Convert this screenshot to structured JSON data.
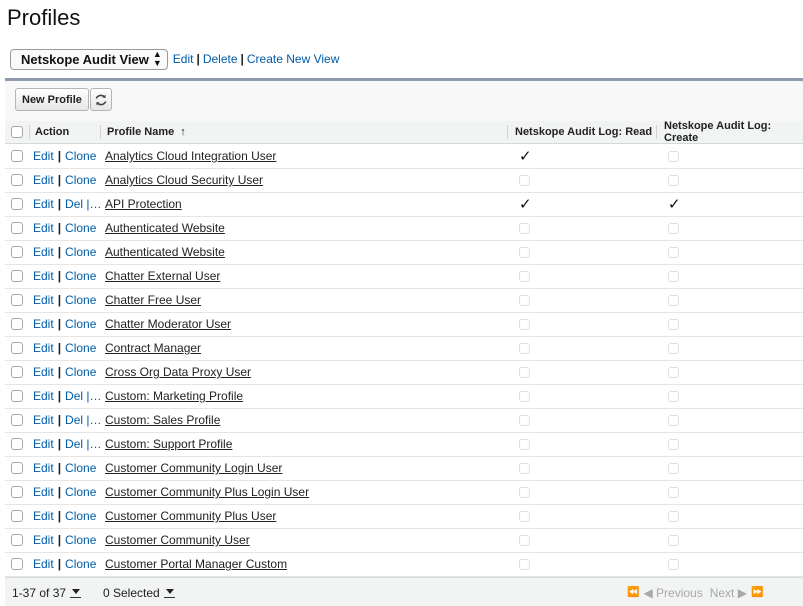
{
  "page_title": "Profiles",
  "view": {
    "selected": "Netskope Audit View",
    "edit_label": "Edit",
    "delete_label": "Delete",
    "create_label": "Create New View"
  },
  "toolbar": {
    "new_profile_label": "New Profile",
    "refresh_icon": "refresh-icon"
  },
  "columns": {
    "action": "Action",
    "profile_name": "Profile Name",
    "sort_indicator": "↑",
    "read": "Netskope Audit Log: Read",
    "create": "Netskope Audit Log: Create"
  },
  "rows": [
    {
      "action1": "Edit",
      "action2": "Clone",
      "name": "Analytics Cloud Integration User",
      "read": true,
      "create": false
    },
    {
      "action1": "Edit",
      "action2": "Clone",
      "name": "Analytics Cloud Security User",
      "read": false,
      "create": false
    },
    {
      "action1": "Edit",
      "action2": "Del |…",
      "name": "API Protection",
      "read": true,
      "create": true
    },
    {
      "action1": "Edit",
      "action2": "Clone",
      "name": "Authenticated Website",
      "read": false,
      "create": false
    },
    {
      "action1": "Edit",
      "action2": "Clone",
      "name": "Authenticated Website",
      "read": false,
      "create": false
    },
    {
      "action1": "Edit",
      "action2": "Clone",
      "name": "Chatter External User",
      "read": false,
      "create": false
    },
    {
      "action1": "Edit",
      "action2": "Clone",
      "name": "Chatter Free User",
      "read": false,
      "create": false
    },
    {
      "action1": "Edit",
      "action2": "Clone",
      "name": "Chatter Moderator User",
      "read": false,
      "create": false
    },
    {
      "action1": "Edit",
      "action2": "Clone",
      "name": "Contract Manager",
      "read": false,
      "create": false
    },
    {
      "action1": "Edit",
      "action2": "Clone",
      "name": "Cross Org Data Proxy User",
      "read": false,
      "create": false
    },
    {
      "action1": "Edit",
      "action2": "Del |…",
      "name": "Custom: Marketing Profile",
      "read": false,
      "create": false
    },
    {
      "action1": "Edit",
      "action2": "Del |…",
      "name": "Custom: Sales Profile",
      "read": false,
      "create": false
    },
    {
      "action1": "Edit",
      "action2": "Del |…",
      "name": "Custom: Support Profile",
      "read": false,
      "create": false
    },
    {
      "action1": "Edit",
      "action2": "Clone",
      "name": "Customer Community Login User",
      "read": false,
      "create": false
    },
    {
      "action1": "Edit",
      "action2": "Clone",
      "name": "Customer Community Plus Login User",
      "read": false,
      "create": false
    },
    {
      "action1": "Edit",
      "action2": "Clone",
      "name": "Customer Community Plus User",
      "read": false,
      "create": false
    },
    {
      "action1": "Edit",
      "action2": "Clone",
      "name": "Customer Community User",
      "read": false,
      "create": false
    },
    {
      "action1": "Edit",
      "action2": "Clone",
      "name": "Customer Portal Manager Custom",
      "read": false,
      "create": false
    }
  ],
  "footer": {
    "range": "1-37 of 37",
    "selected": "0 Selected",
    "first_icon": "⏪",
    "prev_label": "◀ Previous",
    "next_label": "Next ▶",
    "last_icon": "⏩"
  },
  "check_glyph": "✓"
}
